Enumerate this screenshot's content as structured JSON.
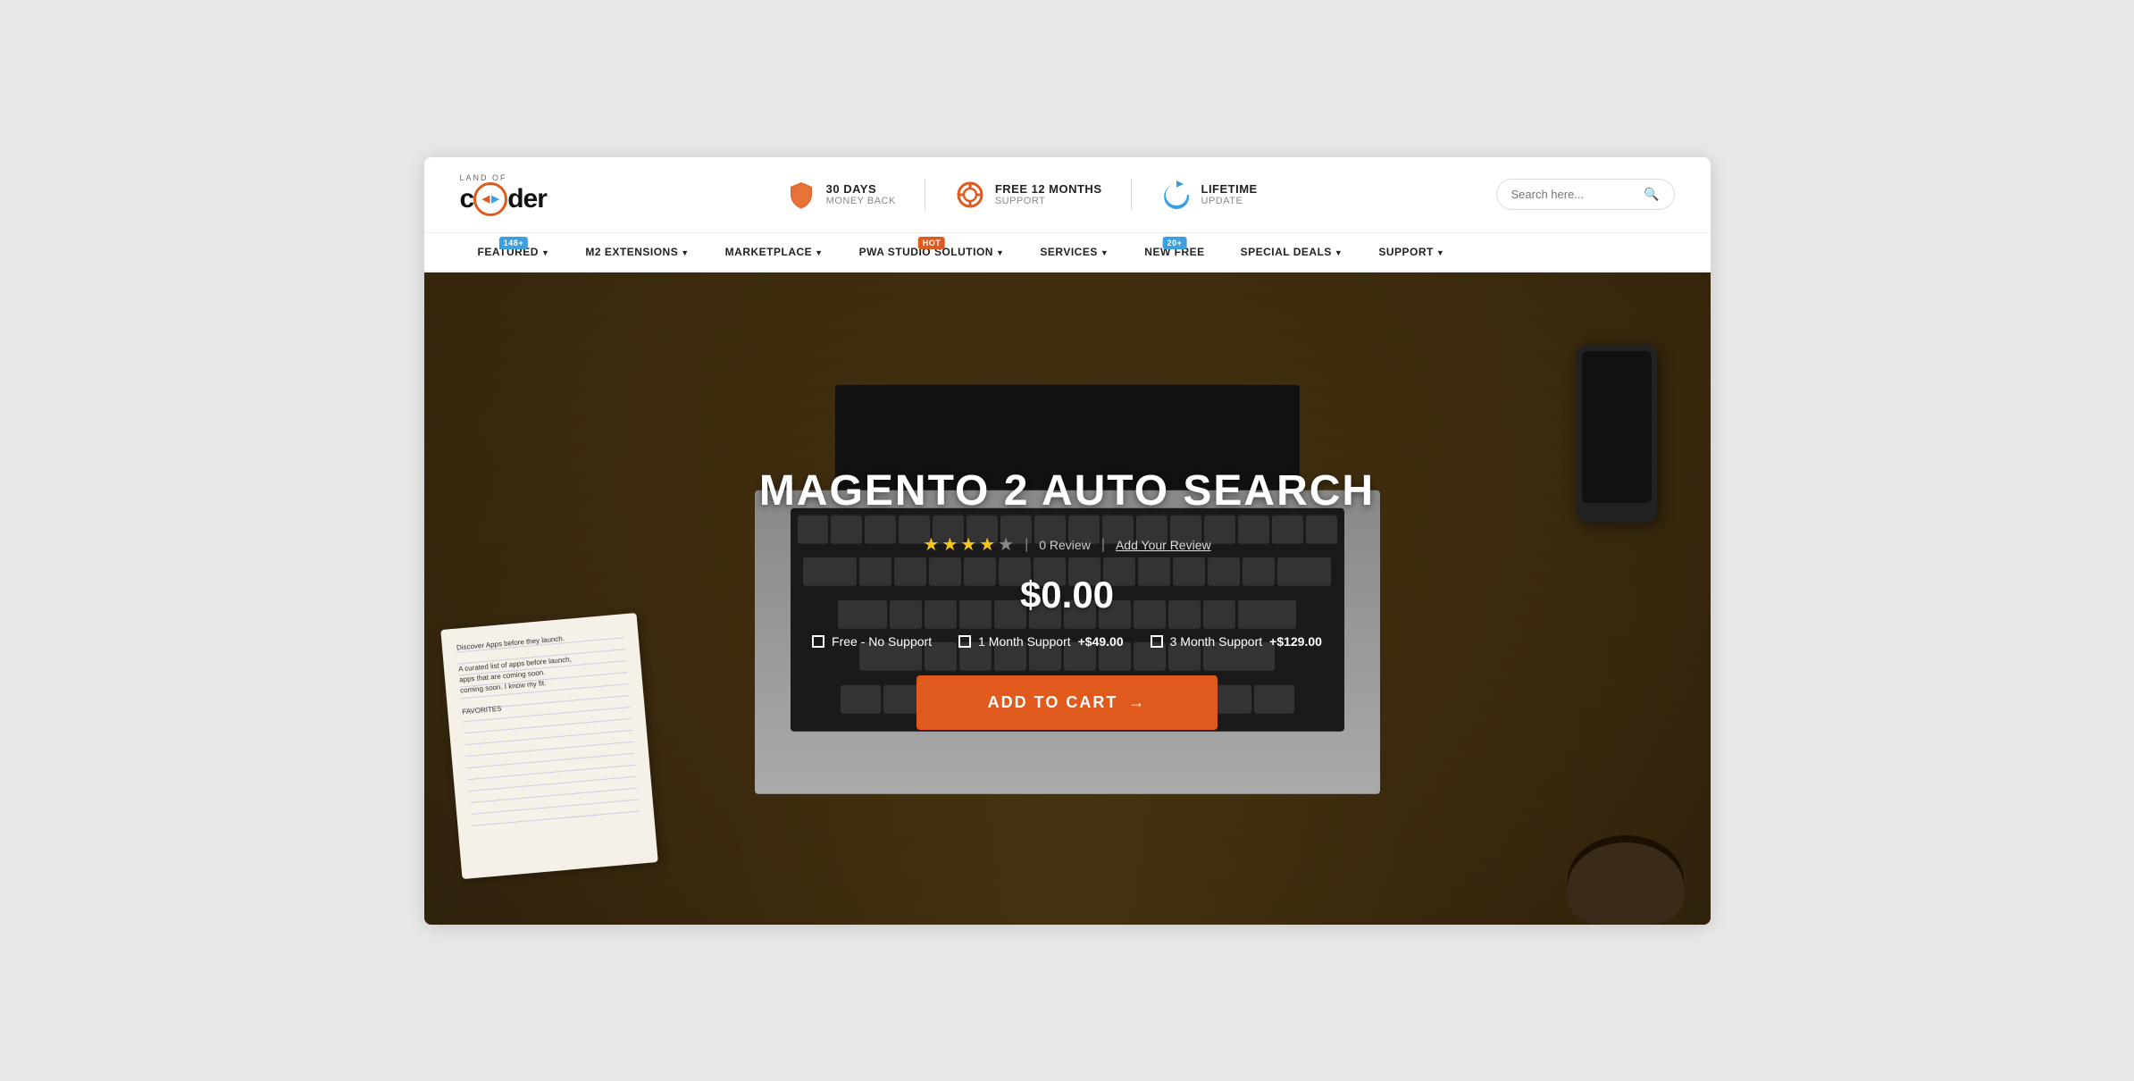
{
  "logo": {
    "land_of": "LAND OF",
    "main": "coder",
    "url": "#"
  },
  "header": {
    "badge1": {
      "icon": "shield",
      "title": "30 DAYS",
      "subtitle": "MONEY BACK"
    },
    "badge2": {
      "icon": "lifebuoy",
      "title": "FREE 12 MONTHS",
      "subtitle": "SUPPORT"
    },
    "badge3": {
      "icon": "refresh",
      "title": "LIFETIME",
      "subtitle": "UPDATE"
    },
    "search_placeholder": "Search here..."
  },
  "nav": {
    "items": [
      {
        "label": "FEATURED",
        "has_dropdown": true,
        "badge": "148+",
        "badge_color": "blue"
      },
      {
        "label": "M2 EXTENSIONS",
        "has_dropdown": true,
        "badge": null
      },
      {
        "label": "MARKETPLACE",
        "has_dropdown": true,
        "badge": null
      },
      {
        "label": "PWA STUDIO SOLUTION",
        "has_dropdown": true,
        "badge": "HOT",
        "badge_color": "hot"
      },
      {
        "label": "SERVICES",
        "has_dropdown": true,
        "badge": null
      },
      {
        "label": "NEW FREE",
        "has_dropdown": false,
        "badge": "20+",
        "badge_color": "blue"
      },
      {
        "label": "SPECIAL DEALS",
        "has_dropdown": true,
        "badge": null
      },
      {
        "label": "SUPPORT",
        "has_dropdown": true,
        "badge": null
      }
    ]
  },
  "hero": {
    "title": "MAGENTO 2 AUTO SEARCH",
    "stars": [
      true,
      true,
      true,
      true,
      false
    ],
    "review_count": "0 Review",
    "add_review_text": "Add Your Review",
    "price": "$0.00",
    "options": [
      {
        "label": "Free - No Support",
        "price_add": "",
        "checked": false
      },
      {
        "label": "1 Month Support",
        "price_add": "+$49.00",
        "checked": false
      },
      {
        "label": "3 Month Support",
        "price_add": "+$129.00",
        "checked": false
      }
    ],
    "add_to_cart_label": "ADD TO CART",
    "arrow": "→"
  }
}
